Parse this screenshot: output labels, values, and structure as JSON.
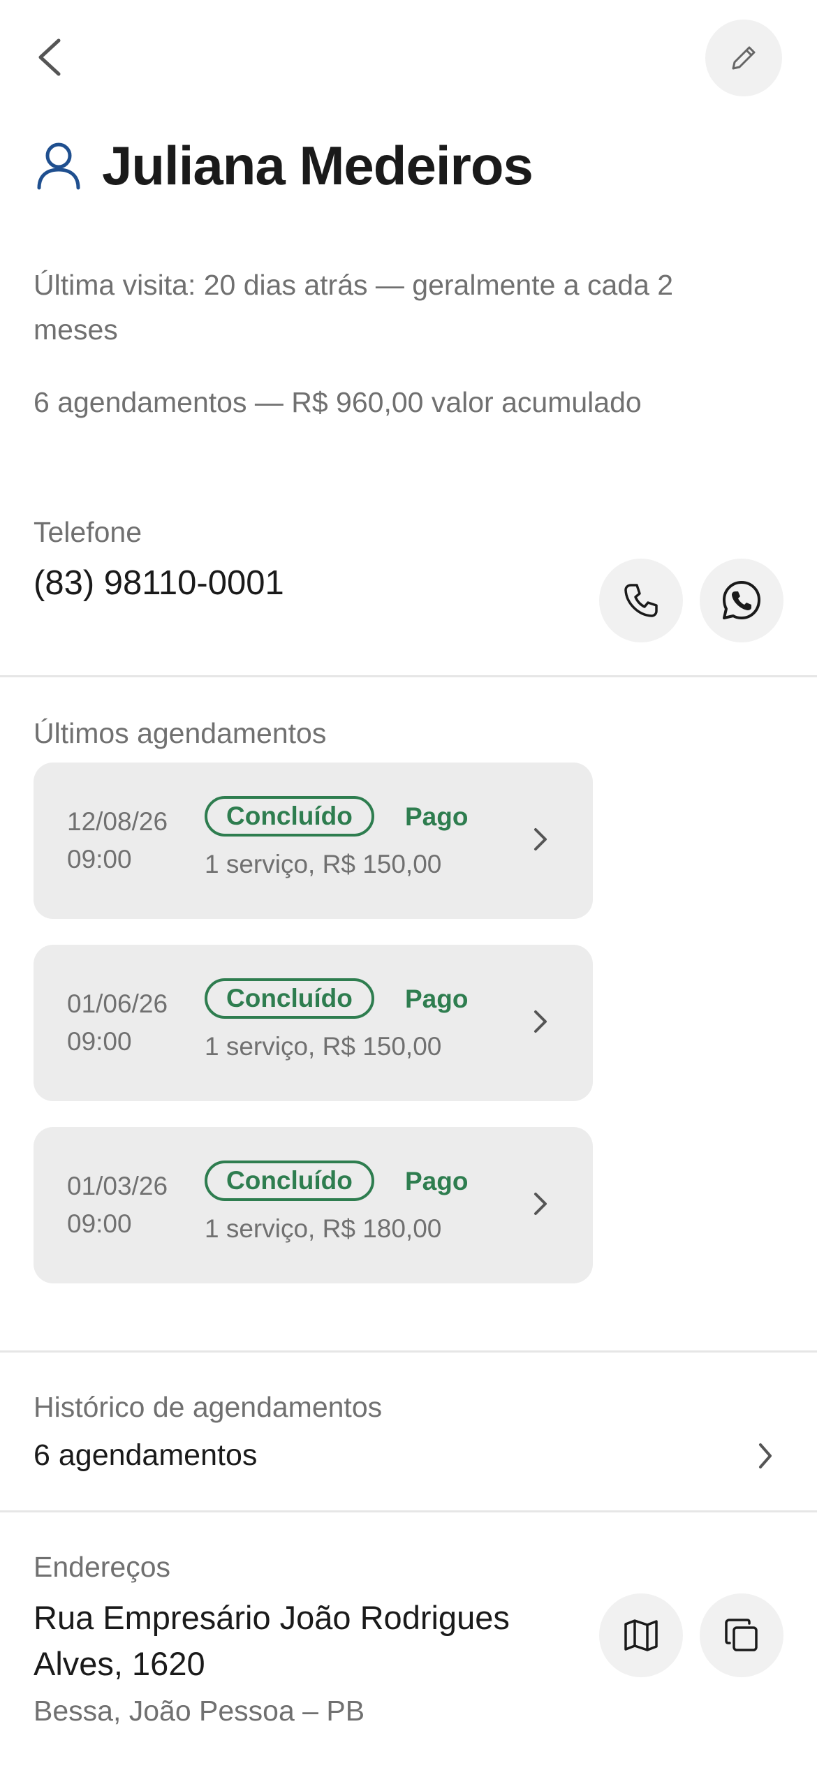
{
  "header": {
    "back_icon": "chevron-left-icon",
    "edit_icon": "pencil-icon"
  },
  "client": {
    "name": "Juliana Medeiros",
    "icon": "user-icon",
    "last_visit": "Última visita: 20 dias atrás — geralmente a cada 2 meses",
    "summary": "6 agendamentos — R$ 960,00 valor acumulado"
  },
  "phone": {
    "label": "Telefone",
    "number": "(83) 98110-0001",
    "call_icon": "phone-icon",
    "whatsapp_icon": "whatsapp-icon"
  },
  "recent": {
    "title": "Últimos agendamentos",
    "items": [
      {
        "date": "12/08/26",
        "time": "09:00",
        "status": "Concluído",
        "payment": "Pago",
        "details": "1 serviço, R$ 150,00"
      },
      {
        "date": "01/06/26",
        "time": "09:00",
        "status": "Concluído",
        "payment": "Pago",
        "details": "1 serviço, R$ 150,00"
      },
      {
        "date": "01/03/26",
        "time": "09:00",
        "status": "Concluído",
        "payment": "Pago",
        "details": "1 serviço, R$ 180,00"
      }
    ]
  },
  "history": {
    "label": "Histórico de agendamentos",
    "value": "6 agendamentos"
  },
  "addresses": {
    "label": "Endereços",
    "street": "Rua Empresário João Rodrigues Alves, 1620",
    "city": "Bessa, João Pessoa – PB",
    "map_icon": "map-icon",
    "copy_icon": "copy-icon"
  },
  "colors": {
    "accent_green": "#2e7d4f",
    "user_icon_blue": "#1f4f8f",
    "card_bg": "#ececec",
    "muted_text": "#707070"
  }
}
